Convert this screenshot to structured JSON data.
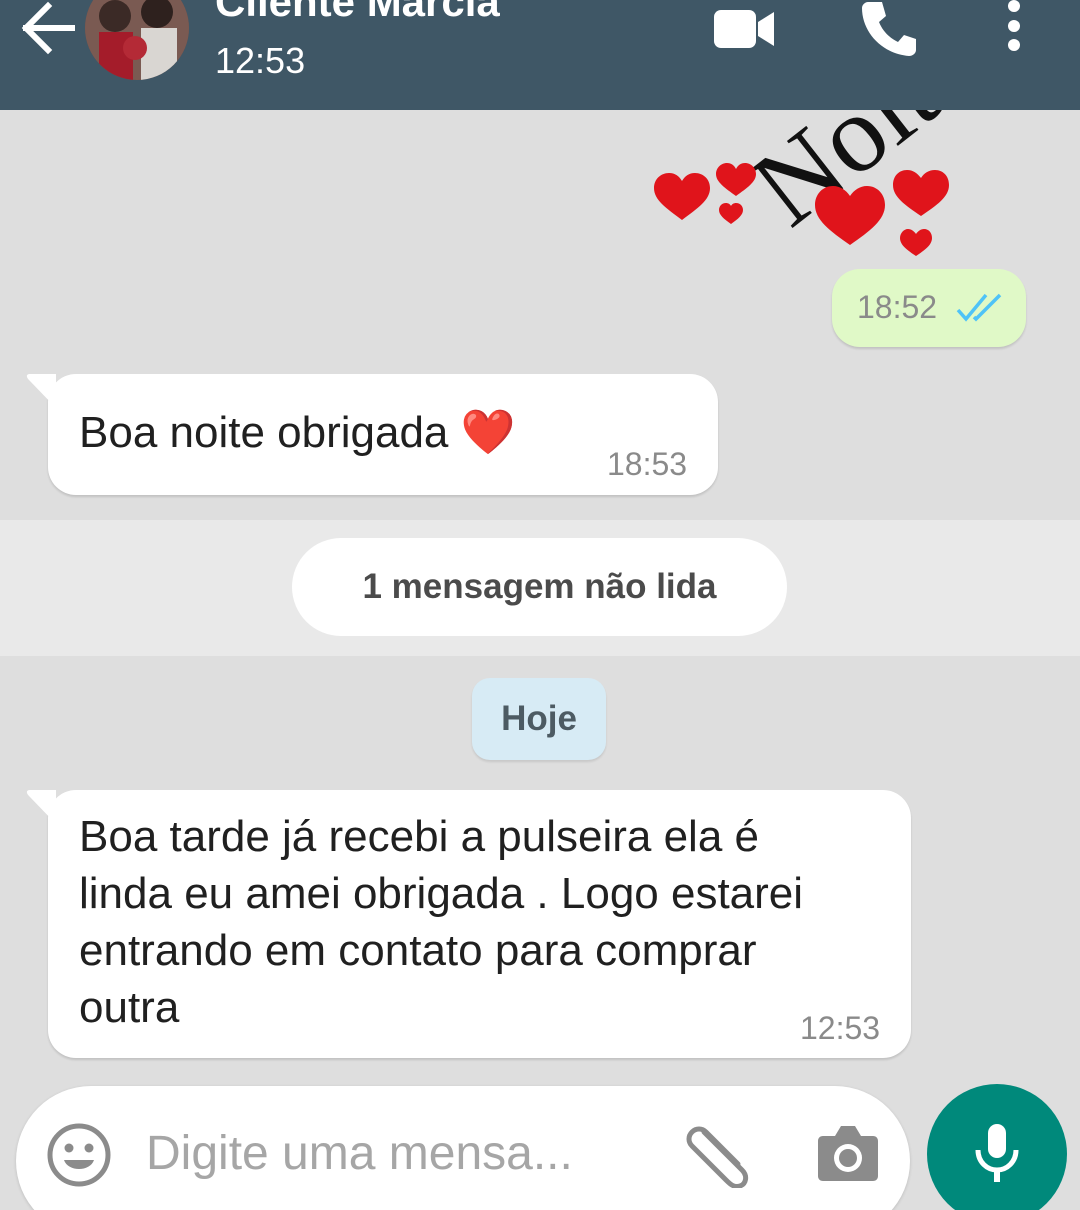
{
  "header": {
    "contact_name": "Cliente Marcia",
    "last_seen": "12:53"
  },
  "sticker": {
    "text": "Noite"
  },
  "messages": {
    "outgoing_1": {
      "time": "18:52"
    },
    "incoming_1": {
      "text": "Boa noite obrigada ❤️",
      "time": "18:53"
    },
    "unread_label": "1 mensagem não lida",
    "date_label": "Hoje",
    "incoming_2": {
      "line1": "Boa tarde já recebi a pulseira ela é",
      "line2": "linda eu amei obrigada . Logo estarei",
      "line3": "entrando em contato para comprar",
      "line4": "outra",
      "time": "12:53"
    }
  },
  "composer": {
    "placeholder": "Digite uma mensa..."
  },
  "colors": {
    "header": "#3f5766",
    "outgoing_bubble": "#e0f9c7",
    "incoming_bubble": "#ffffff",
    "date_chip": "#d7ebf5",
    "mic_button": "#00897b",
    "read_ticks": "#4fc3f7"
  }
}
